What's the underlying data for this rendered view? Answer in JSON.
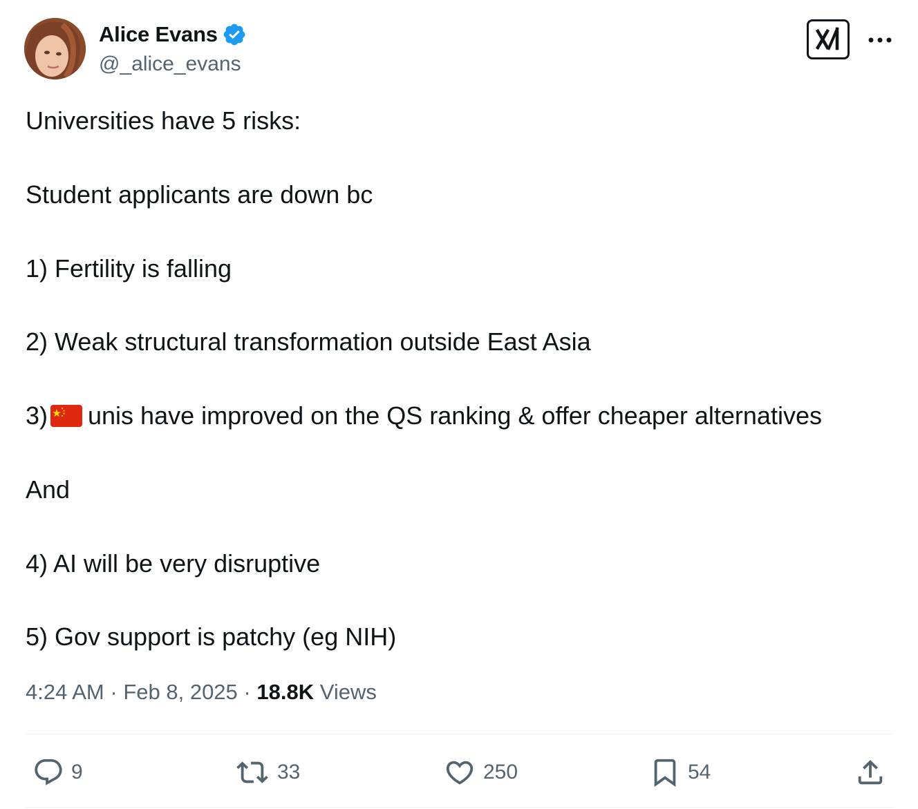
{
  "author": {
    "display_name": "Alice Evans",
    "handle": "@_alice_evans",
    "verified": true
  },
  "tweet": {
    "lines": [
      "Universities have 5 risks:",
      "Student applicants are down bc",
      "1) Fertility is falling",
      "2) Weak structural transformation outside East Asia",
      "3)",
      "unis have improved on the QS ranking & offer cheaper alternatives",
      "And",
      "4) AI will be very disruptive",
      "5) Gov support is patchy (eg NIH)"
    ],
    "flag_icon": "china-flag-icon"
  },
  "meta": {
    "time": "4:24 AM",
    "separator": "·",
    "date": "Feb 8, 2025",
    "views_count": "18.8K",
    "views_label": "Views"
  },
  "actions": {
    "replies": "9",
    "reposts": "33",
    "likes": "250",
    "bookmarks": "54"
  },
  "colors": {
    "text_primary": "#0f1419",
    "text_secondary": "#536471",
    "verified_blue": "#1d9bf0",
    "divider": "#eff3f4",
    "flag_red": "#de2910",
    "flag_yellow": "#ffde00"
  },
  "icons": {
    "verified": "verified-badge-icon",
    "grok": "grok-icon",
    "more": "more-dots-icon",
    "reply": "reply-icon",
    "repost": "repost-icon",
    "like": "heart-icon",
    "bookmark": "bookmark-icon",
    "share": "share-icon"
  }
}
